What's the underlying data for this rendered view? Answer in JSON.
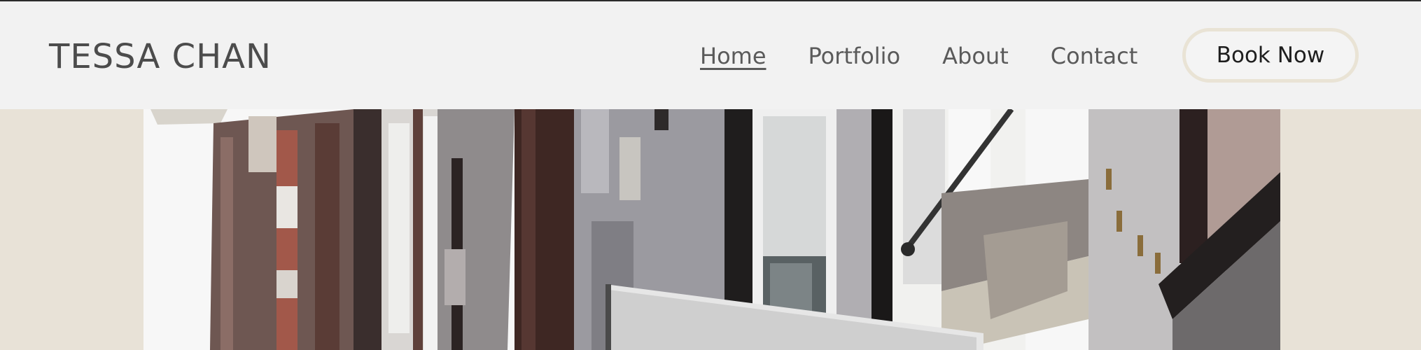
{
  "header": {
    "brand": "TESSA CHAN",
    "nav": [
      {
        "label": "Home",
        "active": true
      },
      {
        "label": "Portfolio",
        "active": false
      },
      {
        "label": "About",
        "active": false
      },
      {
        "label": "Contact",
        "active": false
      }
    ],
    "cta_label": "Book Now"
  },
  "colors": {
    "page_background": "#e8e2d7",
    "header_background": "#f2f2f2",
    "button_border": "#e9e3d5",
    "text_dark": "#4c4c4c"
  }
}
